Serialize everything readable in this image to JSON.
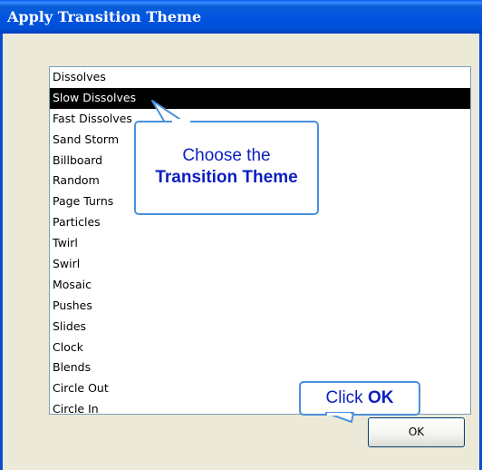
{
  "window": {
    "title": "Apply Transition Theme"
  },
  "list": {
    "items": [
      "Dissolves",
      "Slow Dissolves",
      "Fast Dissolves",
      "Sand Storm",
      "Billboard",
      "Random",
      "Page Turns",
      "Particles",
      "Twirl",
      "Swirl",
      "Mosaic",
      "Pushes",
      "Slides",
      "Clock",
      "Blends",
      "Circle Out",
      "Circle In"
    ],
    "selected_index": 1
  },
  "callouts": {
    "theme": {
      "line1": "Choose the",
      "line2": "Transition Theme"
    },
    "ok": {
      "prefix": "Click ",
      "strong": "OK"
    }
  },
  "buttons": {
    "ok_label": "OK"
  },
  "colors": {
    "titlebar": "#0053e0",
    "callout_border": "#4a90d9",
    "callout_text": "#0b1fbf",
    "selection": "#000000"
  }
}
